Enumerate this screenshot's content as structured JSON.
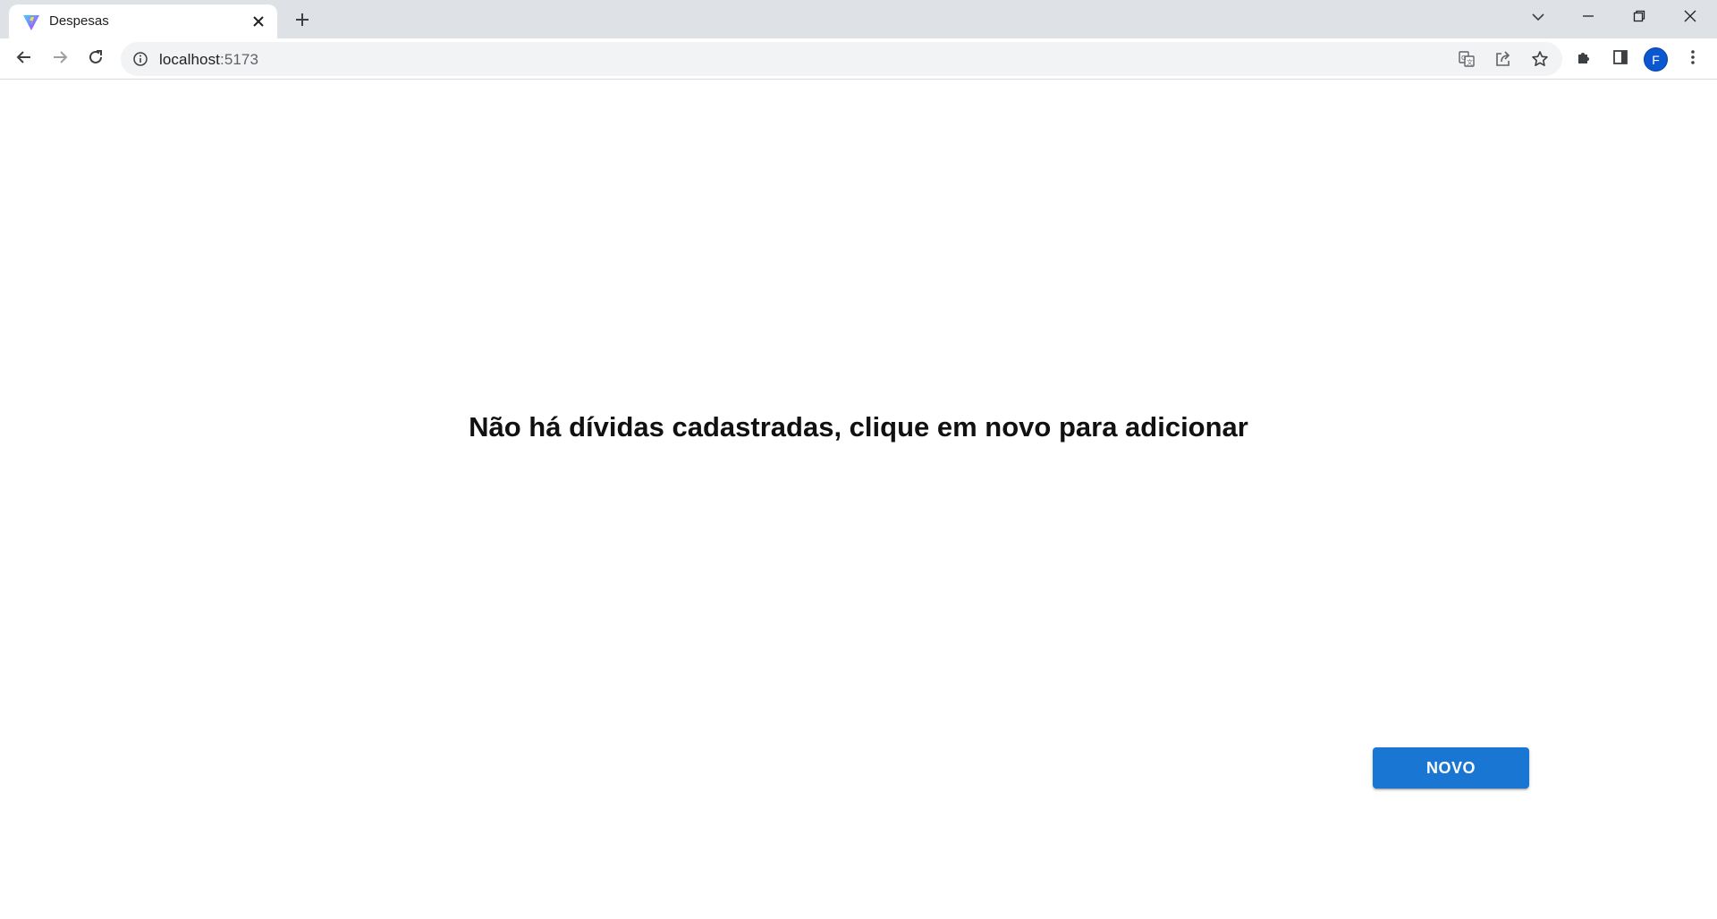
{
  "browser": {
    "tab": {
      "title": "Despesas",
      "favicon": "vite-logo-icon",
      "close_icon": "close-icon"
    },
    "new_tab_icon": "plus-icon",
    "window_controls": [
      "chevron-down-icon",
      "minimize-icon",
      "restore-icon",
      "close-icon"
    ],
    "address_bar": {
      "host": "localhost",
      "port": ":5173",
      "info_icon": "info-icon"
    },
    "toolbar_icons": [
      "back-arrow-icon",
      "forward-arrow-icon",
      "reload-icon",
      "translate-icon",
      "share-icon",
      "star-icon",
      "extensions-icon",
      "side-panel-icon",
      "kebab-menu-icon"
    ],
    "profile_initial": "F"
  },
  "page": {
    "empty_message": "Não há dívidas cadastradas, clique em novo para adicionar",
    "new_button_label": "NOVO"
  },
  "colors": {
    "tabstrip_bg": "#dee1e6",
    "omnibox_bg": "#f1f3f4",
    "primary_button": "#1976d2",
    "avatar": "#0b57d0"
  }
}
